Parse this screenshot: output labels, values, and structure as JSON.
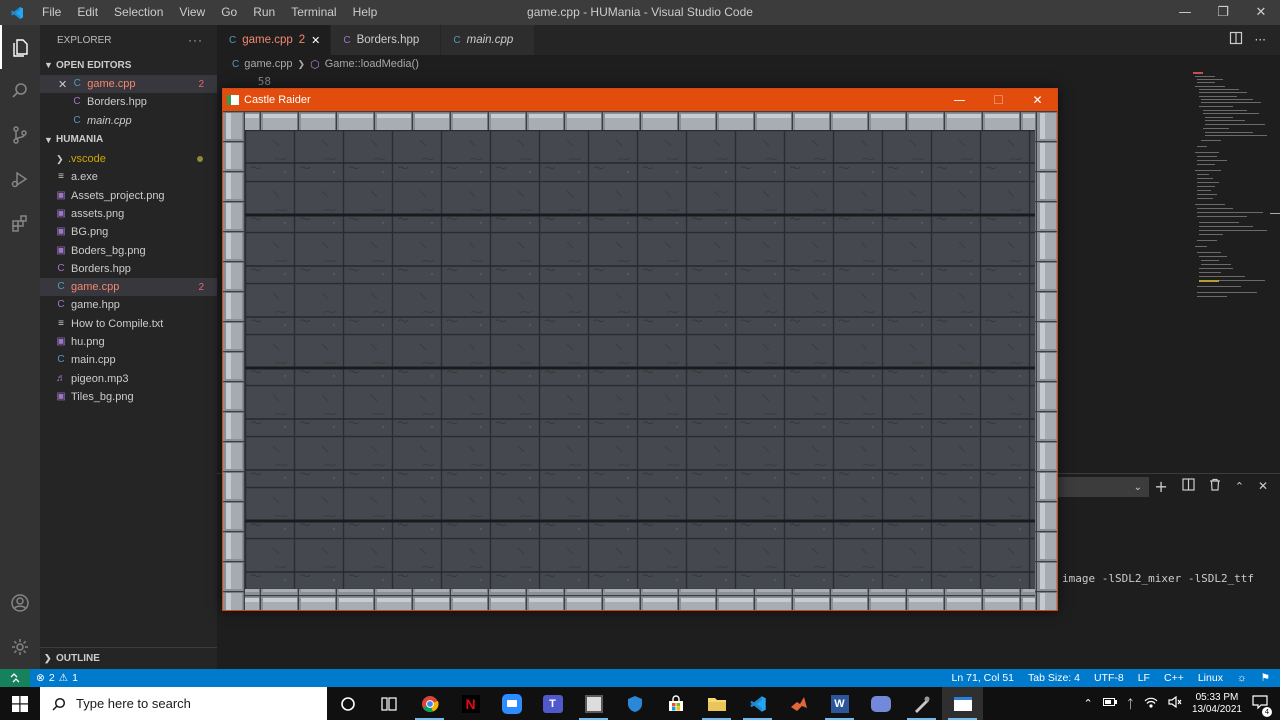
{
  "titlebar": {
    "menu": [
      "File",
      "Edit",
      "Selection",
      "View",
      "Go",
      "Run",
      "Terminal",
      "Help"
    ],
    "window_title": "game.cpp - HUMania - Visual Studio Code"
  },
  "sidebar": {
    "title": "EXPLORER",
    "open_editors_label": "OPEN EDITORS",
    "open_editors": [
      {
        "name": "game.cpp",
        "badge": "2"
      },
      {
        "name": "Borders.hpp"
      },
      {
        "name": "main.cpp"
      }
    ],
    "project_label": "HUMANIA",
    "files": [
      {
        "name": ".vscode",
        "kind": "folder"
      },
      {
        "name": "a.exe"
      },
      {
        "name": "Assets_project.png"
      },
      {
        "name": "assets.png"
      },
      {
        "name": "BG.png"
      },
      {
        "name": "Boders_bg.png"
      },
      {
        "name": "Borders.hpp"
      },
      {
        "name": "game.cpp",
        "badge": "2"
      },
      {
        "name": "game.hpp"
      },
      {
        "name": "How to Compile.txt"
      },
      {
        "name": "hu.png"
      },
      {
        "name": "main.cpp"
      },
      {
        "name": "pigeon.mp3"
      },
      {
        "name": "Tiles_bg.png"
      }
    ],
    "outline_label": "OUTLINE"
  },
  "tabs": [
    {
      "label": "game.cpp",
      "badge": "2"
    },
    {
      "label": "Borders.hpp"
    },
    {
      "label": "main.cpp"
    }
  ],
  "breadcrumb": {
    "file": "game.cpp",
    "symbol": "Game::loadMedia()"
  },
  "editor": {
    "line_number": "58"
  },
  "terminal": {
    "visible_text": "image -lSDL2_mixer -lSDL2_ttf"
  },
  "statusbar": {
    "errors": "2",
    "warnings": "1",
    "position": "Ln 71, Col 51",
    "tab_size": "Tab Size: 4",
    "encoding": "UTF-8",
    "eol": "LF",
    "language": "C++",
    "platform": "Linux"
  },
  "game_window": {
    "title": "Castle Raider"
  },
  "taskbar": {
    "search_placeholder": "Type here to search",
    "time": "05:33 PM",
    "date": "13/04/2021",
    "notification_count": "4"
  },
  "colors": {
    "accent": "#007acc",
    "game_titlebar": "#e24c0d",
    "error_text": "#f48771"
  }
}
